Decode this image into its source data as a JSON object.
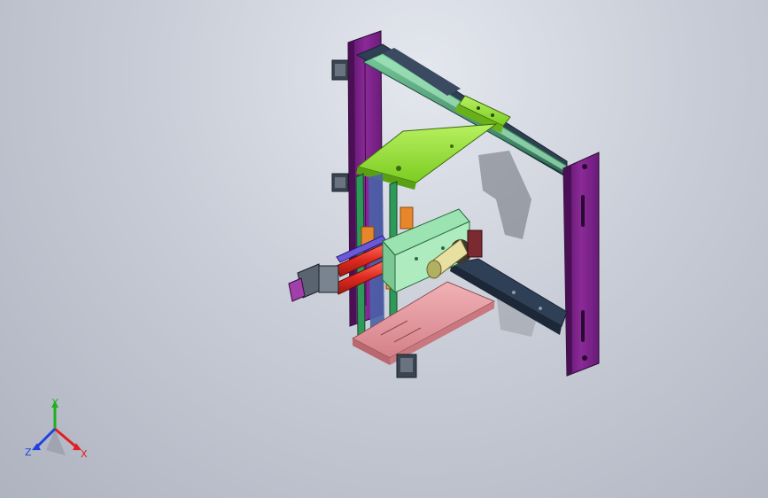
{
  "viewport": {
    "background_top": "#e4e7ee",
    "background_bottom": "#aeb3c0"
  },
  "colors": {
    "frame_purple": "#7a1f86",
    "rail_green": "#3c8a6a",
    "plate_lime": "#8be02a",
    "plate_dark": "#2f3f55",
    "base_pink": "#e59aa0",
    "rod_red": "#e0302a",
    "block_orange": "#e8862a",
    "bracket_mint": "#9be3b0",
    "motor_gray": "#5a6470",
    "axis_x": "#e02020",
    "axis_y": "#20b020",
    "axis_z": "#2040e0"
  },
  "triad": {
    "x_label": "X",
    "y_label": "Y",
    "z_label": "Z"
  }
}
